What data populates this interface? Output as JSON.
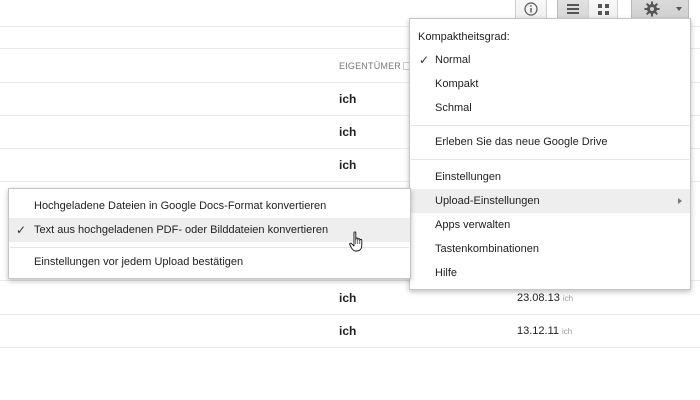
{
  "toolbar": {
    "info_icon": "info-icon",
    "list_view_icon": "list-icon",
    "grid_view_icon": "grid-icon",
    "settings_icon": "gear-icon"
  },
  "table": {
    "owner_header": "EIGENTÜMER",
    "rows": [
      {
        "owner": "ich",
        "date": "",
        "by": ""
      },
      {
        "owner": "ich",
        "date": "",
        "by": ""
      },
      {
        "owner": "ich",
        "date": "",
        "by": ""
      },
      {
        "owner": "ich",
        "date": "23.08.13",
        "by": "ich"
      },
      {
        "owner": "ich",
        "date": "13.12.11",
        "by": "ich"
      }
    ]
  },
  "settings_menu": {
    "density_label": "Kompaktheitsgrad:",
    "density_options": [
      "Normal",
      "Kompakt",
      "Schmal"
    ],
    "density_selected": "Normal",
    "new_drive": "Erleben Sie das neue Google Drive",
    "items": [
      "Einstellungen",
      "Upload-Einstellungen",
      "Apps verwalten",
      "Tastenkombinationen",
      "Hilfe"
    ],
    "highlighted": "Upload-Einstellungen"
  },
  "upload_submenu": {
    "items": [
      "Hochgeladene Dateien in Google Docs-Format konvertieren",
      "Text aus hochgeladenen PDF- oder Bilddateien konvertieren",
      "Einstellungen vor jedem Upload bestätigen"
    ],
    "checked": "Text aus hochgeladenen PDF- oder Bilddateien konvertieren"
  },
  "colors": {
    "menu_border": "#c6c6c6",
    "highlight": "#eeeeee",
    "row_divider": "#ebebeb"
  }
}
